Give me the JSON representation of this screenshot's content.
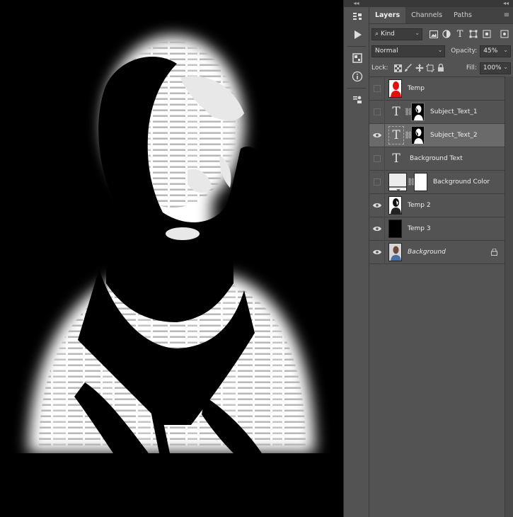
{
  "panel": {
    "tabs": [
      {
        "label": "Layers",
        "active": true
      },
      {
        "label": "Channels",
        "active": false
      },
      {
        "label": "Paths",
        "active": false
      }
    ],
    "filter": {
      "kind": "Kind"
    },
    "blend_mode": "Normal",
    "opacity_label": "Opacity:",
    "opacity_value": "45%",
    "lock_label": "Lock:",
    "fill_label": "Fill:",
    "fill_value": "100%"
  },
  "layers": [
    {
      "name": "Temp",
      "visible": false,
      "type": "image",
      "thumb_color": "#e01010"
    },
    {
      "name": "Subject_Text_1",
      "visible": false,
      "type": "text-masked"
    },
    {
      "name": "Subject_Text_2",
      "visible": true,
      "type": "text-masked",
      "selected": true
    },
    {
      "name": "Background Text",
      "visible": false,
      "type": "text"
    },
    {
      "name": "Background Color",
      "visible": false,
      "type": "fill-masked"
    },
    {
      "name": "Temp 2",
      "visible": true,
      "type": "image"
    },
    {
      "name": "Temp 3",
      "visible": true,
      "type": "image-black"
    },
    {
      "name": "Background",
      "visible": true,
      "type": "photo",
      "locked": true
    }
  ],
  "colors": {
    "panel_bg": "#535353",
    "selected_row": "#6a6a6a",
    "canvas_bg": "#000000"
  }
}
